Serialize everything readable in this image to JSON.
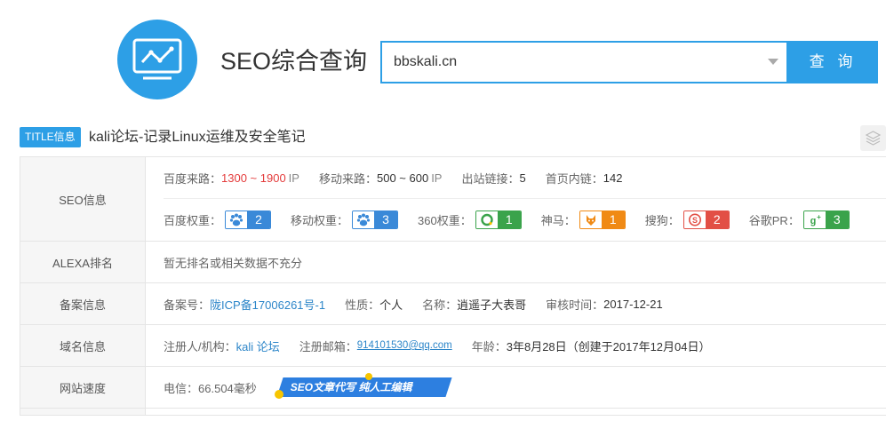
{
  "header": {
    "logo_icon": "chart-monitor-icon",
    "title": "SEO综合查询",
    "search_value": "bbskali.cn",
    "search_button": "查 询"
  },
  "title_row": {
    "badge": "TITLE信息",
    "text": "kali论坛-记录Linux运维及安全笔记"
  },
  "seo": {
    "label": "SEO信息",
    "baidu_traffic_label": "百度来路：",
    "baidu_traffic_value": "1300 ~ 1900",
    "baidu_traffic_unit": "IP",
    "mobile_traffic_label": "移动来路：",
    "mobile_traffic_value": "500 ~ 600",
    "mobile_traffic_unit": "IP",
    "outbound_label": "出站链接：",
    "outbound_value": "5",
    "inbound_label": "首页内链：",
    "inbound_value": "142",
    "baidu_weight_label": "百度权重：",
    "baidu_weight_value": "2",
    "mobile_weight_label": "移动权重：",
    "mobile_weight_value": "3",
    "w360_label": "360权重：",
    "w360_value": "1",
    "shenma_label": "神马：",
    "shenma_value": "1",
    "sogou_label": "搜狗：",
    "sogou_value": "2",
    "google_label": "谷歌PR：",
    "google_value": "3"
  },
  "alexa": {
    "label": "ALEXA排名",
    "text": "暂无排名或相关数据不充分"
  },
  "icp": {
    "label": "备案信息",
    "num_label": "备案号：",
    "num_value": "陇ICP备17006261号-1",
    "type_label": "性质：",
    "type_value": "个人",
    "name_label": "名称：",
    "name_value": "逍遥子大表哥",
    "date_label": "审核时间：",
    "date_value": "2017-12-21"
  },
  "domain": {
    "label": "域名信息",
    "registrant_label": "注册人/机构：",
    "registrant_value": "kali 论坛",
    "email_label": "注册邮箱：",
    "email_value": "914101530@qq.com",
    "age_label": "年龄：",
    "age_value": "3年8月28日（创建于2017年12月04日）"
  },
  "speed": {
    "label": "网站速度",
    "telecom_label": "电信：",
    "telecom_value": "66.504毫秒",
    "promo_text": "SEO文章代写  纯人工编辑"
  },
  "colors": {
    "accent": "#2d9fe6",
    "red": "#e43c3c",
    "baidu_badge": "#3a89d8",
    "green_badge": "#3aa34b",
    "orange_badge": "#f08a15",
    "sogou_badge": "#e24f45"
  }
}
